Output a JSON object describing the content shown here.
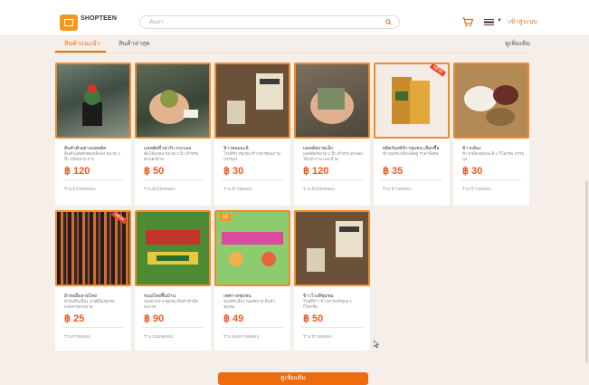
{
  "header": {
    "brand": "SHOPTEEN",
    "brand_sub": "",
    "search_placeholder": "ค้นหา",
    "login_label": "เข้าสู่ระบบ"
  },
  "tabs": [
    {
      "label": "สินค้าแนะนำ"
    },
    {
      "label": "สินค้าล่าสุด"
    }
  ],
  "see_all_label": "ดูเพิ่มเติม",
  "products": [
    {
      "name": "สินค้าตัวอย่างแคคตัส",
      "desc": "สินค้าแคคตัสดอกสีแดง ขนาด 2 นิ้ว พร้อมกระถาง",
      "price": "฿ 120",
      "shop": "ร้าน ต้นไม้ทดสอบ"
    },
    {
      "name": "แคคตัสจิ๋วน่ารัก กระบอง",
      "desc": "ต้นไม้มงคล ขนาด 2 นิ้ว สำหรับตกแต่งบ้าน",
      "price": "฿ 50",
      "shop": "ร้าน ต้นไม้ทดสอบ"
    },
    {
      "name": "ข้าวหอมมะลิ",
      "desc": "โรงสีข้าวชุมชน ข้าวสารคุณภาพ บรรจุถุง",
      "price": "฿ 30",
      "shop": "ร้าน ข้าวทดสอบ"
    },
    {
      "name": "แคคตัสถาดเล็ก",
      "desc": "แคคตัสขนาด 2 นิ้ว สำหรับ ตกแต่งโต๊ะทำงาน และบ้าน",
      "price": "฿ 120",
      "shop": "ร้าน ต้นไม้ทดสอบ"
    },
    {
      "name": "ผลิตภัณฑ์ข้าวชุมชน เลือกซื้อ",
      "desc": "ข้าวออร์แกนิกแพ็คคู่ ราคาพิเศษ",
      "price": "฿ 35",
      "shop": "ร้าน ข้าวทดสอบ"
    },
    {
      "name": "ข้าวกล้อง",
      "desc": "ข้าวกล้องหอมมะลิ 1 กิโลกรัม บรรจุถุง",
      "price": "฿ 30",
      "shop": "ร้าน ข้าวทดสอบ"
    },
    {
      "name": "ผ้าทอมือลายไทย",
      "desc": "ผ้าทอพื้นเมือง งานฝีมือชุมชน ลวดลายสวยงาม",
      "price": "฿ 25",
      "shop": "ร้าน ผ้าทดสอบ"
    },
    {
      "name": "ขนมไทยพื้นบ้าน",
      "desc": "ของฝากจากชุมชน สินค้าทำมือ สะอาด",
      "price": "฿ 90",
      "shop": "ร้าน ขนมทดสอบ"
    },
    {
      "name": "เทศกาลชุมชน",
      "desc": "ของที่ระลึกงานเทศกาล สินค้าชุมชน",
      "price": "฿ 49",
      "shop": "ร้าน ของฝากทดสอบ"
    },
    {
      "name": "ข้าวโรงสีชุมชน",
      "desc": "โรงสีข้าว ข้าวสารบรรจุถุง 1 กิโลกรัม",
      "price": "฿ 50",
      "shop": "ร้าน ข้าวทดสอบ"
    }
  ],
  "load_more_label": "ดูเพิ่มเติม",
  "colors": {
    "accent": "#ee6c0e",
    "price": "#ee5a24",
    "background": "#f6efe9"
  }
}
